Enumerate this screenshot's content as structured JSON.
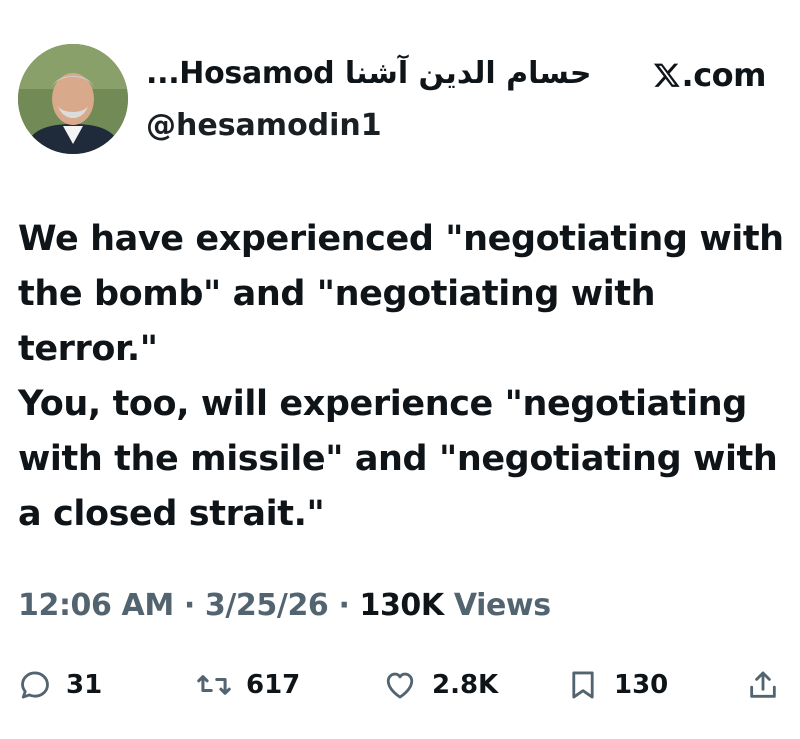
{
  "author": {
    "display_name": "حسام الدين آشنا Hosamod...",
    "handle": "@hesamodin1",
    "avatar_icon": "profile-photo"
  },
  "brand": {
    "logo_icon": "x-logo-icon",
    "text": ".com"
  },
  "tweet": {
    "paragraphs": [
      "We have experienced \"negotiating with the bomb\" and \"negotiating with terror.\"",
      "You, too, will experience \"negotiating with the missile\" and \"negotiating with a closed strait.\""
    ]
  },
  "meta": {
    "time": "12:06 AM",
    "separator": "·",
    "date": "3/25/26",
    "views_count": "130K",
    "views_label": "Views"
  },
  "actions": {
    "replies": "31",
    "reposts": "617",
    "likes": "2.8K",
    "bookmarks": "130"
  },
  "colors": {
    "text": "#0f1419",
    "secondary": "#536471",
    "background": "#ffffff"
  }
}
